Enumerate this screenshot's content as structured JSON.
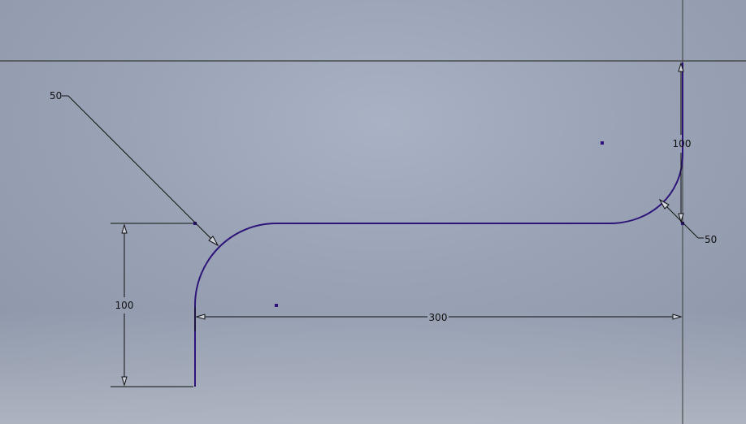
{
  "dimensions": {
    "radius_left": "50",
    "radius_right": "50",
    "height_left": "100",
    "height_right": "100",
    "length_bottom": "300"
  },
  "colors": {
    "profile": "#2e1478",
    "dimension": "#111111",
    "axis": "#3a3a3a",
    "point": "#2e1478"
  }
}
